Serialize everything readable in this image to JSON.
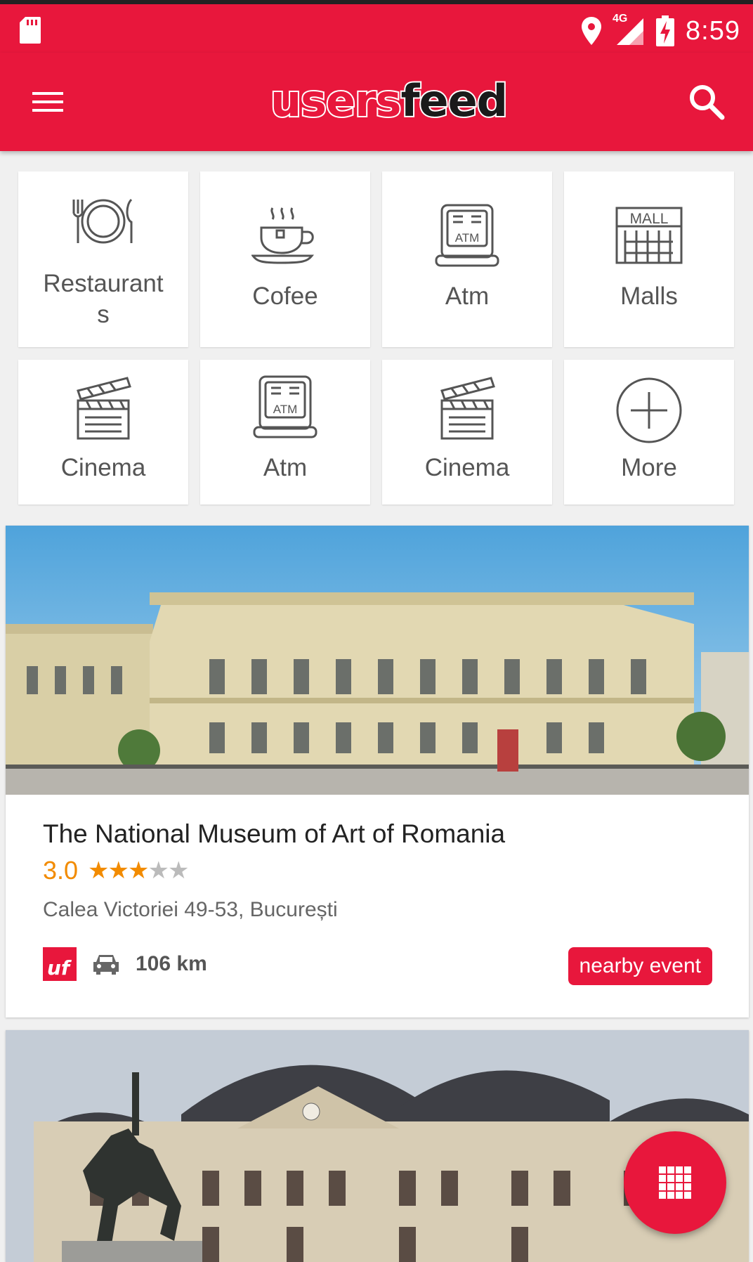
{
  "status_bar": {
    "time": "8:59",
    "network": "4G",
    "icons": [
      "sd-card-icon",
      "location-icon",
      "signal-icon",
      "battery-charging-icon"
    ]
  },
  "app_bar": {
    "logo_part1": "users",
    "logo_part2": "feed",
    "menu_icon": "hamburger-menu-icon",
    "search_icon": "search-icon"
  },
  "categories": [
    {
      "label": "Restaurant\ns",
      "icon": "restaurant-icon"
    },
    {
      "label": "Cofee",
      "icon": "coffee-icon"
    },
    {
      "label": "Atm",
      "icon": "atm-icon"
    },
    {
      "label": "Malls",
      "icon": "mall-icon"
    },
    {
      "label": "Cinema",
      "icon": "cinema-icon"
    },
    {
      "label": "Atm",
      "icon": "atm-icon"
    },
    {
      "label": "Cinema",
      "icon": "cinema-icon"
    },
    {
      "label": "More",
      "icon": "add-circle-icon"
    }
  ],
  "atm_icon_text": "ATM",
  "mall_icon_text": "MALL",
  "cards": [
    {
      "title": "The National Museum of Art of Romania",
      "rating": "3.0",
      "stars_filled": 3,
      "stars_total": 5,
      "address": "Calea Victoriei 49-53, București",
      "source_logo": "uf",
      "distance": "106 km",
      "badge": "nearby event"
    }
  ],
  "colors": {
    "primary": "#e8173c",
    "rating": "#f28b00",
    "sky": "#5fa9d8"
  }
}
